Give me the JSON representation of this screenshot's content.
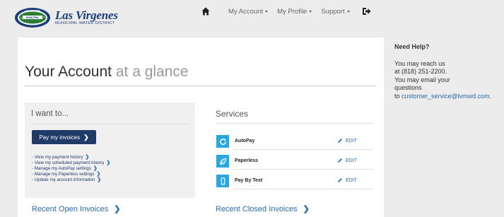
{
  "brand": {
    "title": "Las Virgenes",
    "subtitle": "MUNICIPAL WATER DISTRICT",
    "badge_text": "LAS VIRGENES",
    "badge_sub": "MUNICIPAL"
  },
  "nav": {
    "home_icon": "home-icon",
    "items": [
      {
        "label": "My Account"
      },
      {
        "label": "My Profile"
      },
      {
        "label": "Support"
      }
    ],
    "logout_icon": "logout-icon"
  },
  "page": {
    "title_main": "Your Account",
    "title_light": "at a glance"
  },
  "iwant": {
    "heading": "I want to...",
    "pay_button": "Pay my invoices",
    "links": [
      "- View my payment history",
      "- View my scheduled payment history",
      "- Manage my AutoPay settings",
      "- Manage my Paperless settings",
      "- Update my account information"
    ]
  },
  "services": {
    "heading": "Services",
    "items": [
      {
        "name": "AutoPay",
        "icon": "refresh-icon",
        "edit": "EDIT"
      },
      {
        "name": "Paperless",
        "icon": "leaf-icon",
        "edit": "EDIT"
      },
      {
        "name": "Pay By Text",
        "icon": "mobile-icon",
        "edit": "EDIT"
      }
    ]
  },
  "recent": {
    "open": "Recent Open Invoices",
    "closed": "Recent Closed Invoices"
  },
  "help": {
    "title": "Need Help?",
    "line1": "You may reach us",
    "line2": "at (818) 251-2200.",
    "line3": "You may email your",
    "line4": "questions",
    "line5_prefix": "to ",
    "email": "customer_service@lvmwd.com."
  },
  "colors": {
    "accent": "#2b6cb0",
    "pay_button": "#1f3a66",
    "service_icon": "#29a8e0"
  }
}
